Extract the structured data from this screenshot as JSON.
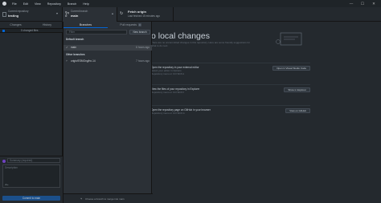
{
  "menu": [
    "File",
    "Edit",
    "View",
    "Repository",
    "Branch",
    "Help"
  ],
  "window_controls": [
    "—",
    "☐",
    "✕"
  ],
  "toolbar": {
    "repo_label": "Current repository",
    "repo_value": "testing",
    "branch_label": "Current branch",
    "branch_value": "main",
    "fetch_title": "Fetch origin",
    "fetch_sub": "Last fetched 15 minutes ago"
  },
  "left_panel": {
    "tab_changes": "Changes",
    "tab_history": "History",
    "files_text": "0 changed files",
    "summary_placeholder": "Summary (required)",
    "description_placeholder": "Description",
    "coauthor_icon": "person-add-icon",
    "commit_button": "Commit to main"
  },
  "dropdown": {
    "tab_branches": "Branches",
    "tab_pull_requests": "Pull requests",
    "pr_count": "0",
    "filter_value": "Filter",
    "new_branch": "New branch",
    "default_header": "Default branch",
    "default_branch": {
      "name": "main",
      "time": "6 hours ago"
    },
    "other_header": "Other branches",
    "other_branches": [
      {
        "name": "origin/ESMOng/hn-14",
        "time": "7 hours ago"
      }
    ],
    "footer_text": "Choose a branch to merge into main"
  },
  "main": {
    "heading": "o local changes",
    "subtext": "There are no uncommitted changes in this repository. Here are some friendly suggestions for what to do next.",
    "actions": [
      {
        "title": "Open the repository in your external editor",
        "hint": "Select your editor in Options",
        "shortcut": "Repository menu or  Ctrl  Shift  A",
        "button": "Open in Visual Studio Code"
      },
      {
        "title": "View the files of your repository in Explorer",
        "hint": "",
        "shortcut": "Repository menu or  Ctrl  Shift  F",
        "button": "Show in Explorer"
      },
      {
        "title": "Open the repository page on GitHub in your browser",
        "hint": "",
        "shortcut": "Repository menu or  Ctrl  Shift  G",
        "button": "View on GitHub"
      }
    ]
  }
}
